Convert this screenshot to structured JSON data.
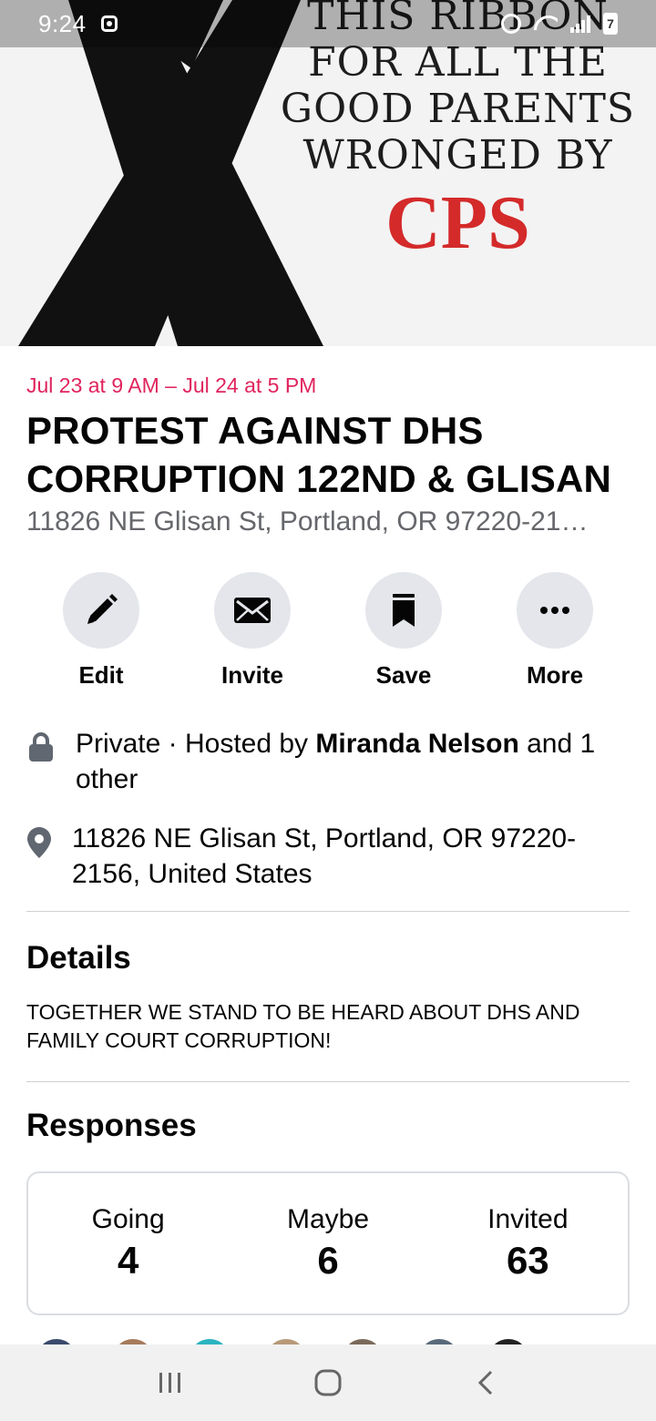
{
  "status_bar": {
    "time": "9:24",
    "battery": "7"
  },
  "cover": {
    "lines": [
      "THIS RIBBON",
      "FOR ALL THE",
      "GOOD PARENTS",
      "WRONGED BY"
    ],
    "highlight": "CPS",
    "highlight_color": "#d42a2a"
  },
  "event": {
    "date": "Jul 23 at 9 AM – Jul 24 at 5 PM",
    "title": "PROTEST AGAINST DHS CORRUPTION 122ND & GLISAN",
    "address_short": "11826 NE Glisan St, Portland, OR 97220-21…"
  },
  "actions": [
    {
      "label": "Edit",
      "icon": "pencil-icon"
    },
    {
      "label": "Invite",
      "icon": "envelope-icon"
    },
    {
      "label": "Save",
      "icon": "bookmark-icon"
    },
    {
      "label": "More",
      "icon": "more-dots-icon"
    }
  ],
  "info": {
    "privacy_prefix": "Private · Hosted by ",
    "host_name": "Miranda Nelson",
    "privacy_suffix": " and 1 other",
    "location": "11826 NE Glisan St, Portland, OR 97220-2156, United States"
  },
  "details": {
    "title": "Details",
    "text": "TOGETHER WE STAND TO BE HEARD ABOUT DHS AND FAMILY COURT CORRUPTION!"
  },
  "responses": {
    "title": "Responses",
    "items": [
      {
        "label": "Going",
        "count": "4"
      },
      {
        "label": "Maybe",
        "count": "6"
      },
      {
        "label": "Invited",
        "count": "63"
      }
    ]
  },
  "colors": {
    "accent_date": "#e0245e",
    "secondary_text": "#65676b",
    "button_bg": "#e4e6eb"
  },
  "nav_icons": [
    "recent-apps-icon",
    "home-icon",
    "back-icon"
  ]
}
